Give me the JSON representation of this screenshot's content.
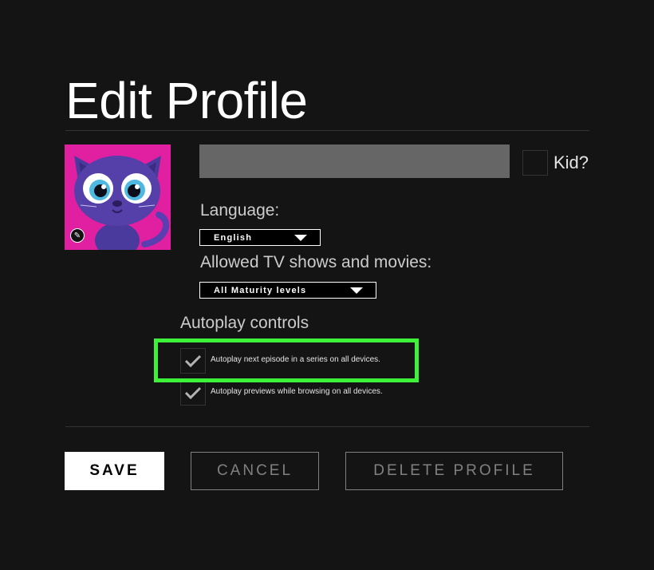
{
  "page": {
    "title": "Edit Profile"
  },
  "profile": {
    "name_value": "",
    "kid_label": "Kid?",
    "kid_checked": false
  },
  "language": {
    "label": "Language:",
    "selected": "English"
  },
  "maturity": {
    "label": "Allowed TV shows and movies:",
    "selected": "All Maturity levels"
  },
  "autoplay": {
    "title": "Autoplay controls",
    "options": [
      {
        "label": "Autoplay next episode in a series on all devices.",
        "checked": true
      },
      {
        "label": "Autoplay previews while browsing on all devices.",
        "checked": true
      }
    ]
  },
  "buttons": {
    "save": "SAVE",
    "cancel": "CANCEL",
    "delete": "DELETE PROFILE"
  },
  "colors": {
    "background": "#141414",
    "highlight": "#3ef23a",
    "avatar_bg": "#e020a0",
    "input_bg": "#666666"
  },
  "icons": {
    "avatar": "cartoon-cat-avatar",
    "edit": "pencil-icon",
    "dropdown": "caret-down-icon",
    "check": "checkmark-icon"
  }
}
